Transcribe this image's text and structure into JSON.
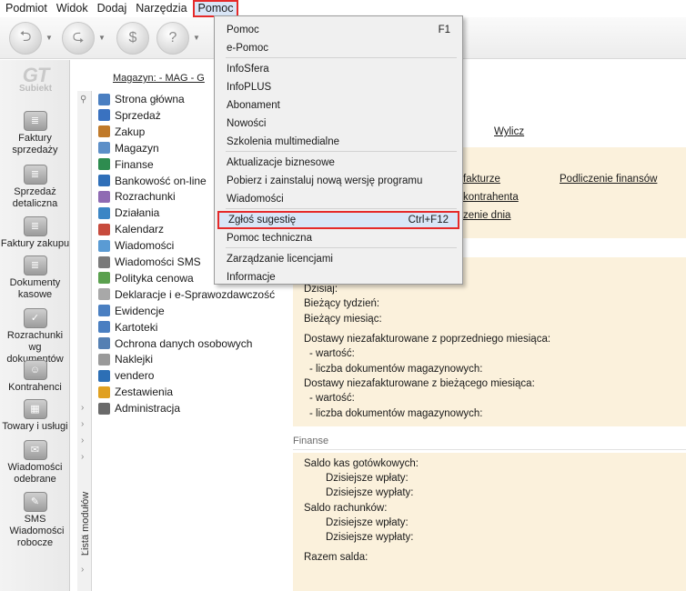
{
  "menubar": {
    "items": [
      "Podmiot",
      "Widok",
      "Dodaj",
      "Narzędzia",
      "Pomoc"
    ],
    "active": "Pomoc"
  },
  "toolbar": {
    "buttons": [
      "back-icon",
      "forward-icon",
      "save-icon",
      "help-icon"
    ]
  },
  "app": {
    "logo_main": "GT",
    "logo_sub": "Subiekt"
  },
  "magazyn_label": "Magazyn: - MAG - G",
  "leftnav": [
    {
      "label": "Faktury sprzedaży",
      "icon": "invoice-icon"
    },
    {
      "label": "Sprzedaż detaliczna",
      "icon": "retail-icon"
    },
    {
      "label": "Faktury zakupu",
      "icon": "purchase-icon"
    },
    {
      "label": "Dokumenty kasowe",
      "icon": "cash-docs-icon"
    },
    {
      "label": "Rozrachunki wg dokumentów",
      "icon": "settlements-icon"
    },
    {
      "label": "Kontrahenci",
      "icon": "contractors-icon"
    },
    {
      "label": "Towary i usługi",
      "icon": "goods-icon"
    },
    {
      "label": "Wiadomości odebrane",
      "icon": "inbox-icon"
    },
    {
      "label": "SMS Wiadomości robocze",
      "icon": "sms-icon"
    }
  ],
  "modules_label": "Lista modułów",
  "modules": [
    {
      "label": "Strona główna",
      "color": "#4a7fc1"
    },
    {
      "label": "Sprzedaż",
      "color": "#3a72c0"
    },
    {
      "label": "Zakup",
      "color": "#c07a2a"
    },
    {
      "label": "Magazyn",
      "color": "#5c8fc8"
    },
    {
      "label": "Finanse",
      "color": "#2e8c4f"
    },
    {
      "label": "Bankowość on-line",
      "color": "#2f6fb8"
    },
    {
      "label": "Rozrachunki",
      "color": "#8f6bb3"
    },
    {
      "label": "Działania",
      "color": "#3c86c5"
    },
    {
      "label": "Kalendarz",
      "color": "#c74b3d"
    },
    {
      "label": "Wiadomości",
      "color": "#5a9bd4"
    },
    {
      "label": "Wiadomości SMS",
      "color": "#7a7a7a"
    },
    {
      "label": "Polityka cenowa",
      "color": "#5aa04e"
    },
    {
      "label": "Deklaracje i e-Sprawozdawczość",
      "color": "#a8a8a8"
    },
    {
      "label": "Ewidencje",
      "color": "#4a7fc1"
    },
    {
      "label": "Kartoteki",
      "color": "#4a7fc1"
    },
    {
      "label": "Ochrona danych osobowych",
      "color": "#5580b3"
    },
    {
      "label": "Naklejki",
      "color": "#9a9a9a"
    },
    {
      "label": "vendero",
      "color": "#2d6fb5"
    },
    {
      "label": "Zestawienia",
      "color": "#e0a020"
    },
    {
      "label": "Administracja",
      "color": "#6a6a6a"
    }
  ],
  "main": {
    "wylicz": "Wylicz",
    "links": {
      "fakturze": "fakturze",
      "kontrahenta": "kontrahenta",
      "zenie_dnia": "zenie dnia",
      "podliczenie": "Podliczenie finansów"
    },
    "stats": {
      "dzisiaj": "Dzisiaj:",
      "tydzien": "Bieżący tydzień:",
      "miesiac": "Bieżący miesiąc:",
      "dostawy_poprz": "Dostawy niezafakturowane z poprzedniego miesiąca:",
      "wartosc1": "- wartość:",
      "liczba1": "- liczba dokumentów magazynowych:",
      "dostawy_biez": "Dostawy niezafakturowane z bieżącego miesiąca:",
      "wartosc2": "- wartość:",
      "liczba2": "- liczba dokumentów magazynowych:"
    },
    "finanse_title": "Finanse",
    "finanse": {
      "saldo_kas": "Saldo kas gotówkowych:",
      "wplaty1": "Dzisiejsze wpłaty:",
      "wyplaty1": "Dzisiejsze wypłaty:",
      "saldo_rach": "Saldo rachunków:",
      "wplaty2": "Dzisiejsze wpłaty:",
      "wyplaty2": "Dzisiejsze wypłaty:",
      "razem": "Razem salda:"
    }
  },
  "dropdown": {
    "items": [
      {
        "label": "Pomoc",
        "shortcut": "F1"
      },
      {
        "label": "e-Pomoc",
        "shortcut": ""
      },
      {
        "label": "InfoSfera",
        "shortcut": ""
      },
      {
        "label": "InfoPLUS",
        "shortcut": ""
      },
      {
        "label": "Abonament",
        "shortcut": ""
      },
      {
        "label": "Nowości",
        "shortcut": ""
      },
      {
        "label": "Szkolenia multimedialne",
        "shortcut": ""
      },
      {
        "label": "Aktualizacje biznesowe",
        "shortcut": ""
      },
      {
        "label": "Pobierz i zainstaluj nową wersję programu",
        "shortcut": ""
      },
      {
        "label": "Wiadomości",
        "shortcut": ""
      },
      {
        "label": "Zgłoś sugestię",
        "shortcut": "Ctrl+F12"
      },
      {
        "label": "Pomoc techniczna",
        "shortcut": ""
      },
      {
        "label": "Zarządzanie licencjami",
        "shortcut": ""
      },
      {
        "label": "Informacje",
        "shortcut": ""
      }
    ],
    "highlighted": "Zgłoś sugestię"
  }
}
